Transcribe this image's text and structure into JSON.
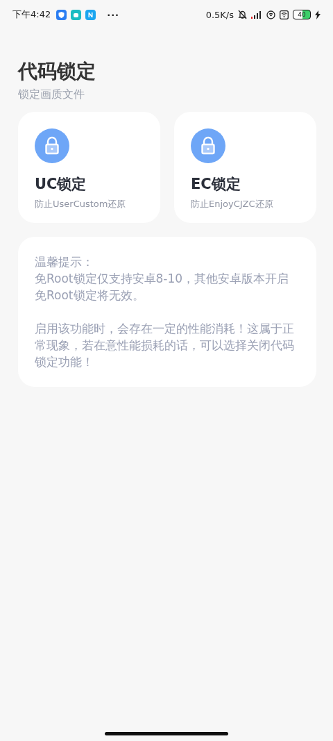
{
  "status_bar": {
    "time": "下午4:42",
    "more": "···",
    "speed": "0.5K/s",
    "battery": "40"
  },
  "header": {
    "title": "代码锁定",
    "subtitle": "锁定画质文件"
  },
  "cards": [
    {
      "title": "UC锁定",
      "subtitle": "防止UserCustom还原"
    },
    {
      "title": "EC锁定",
      "subtitle": "防止EnjoyCJZC还原"
    }
  ],
  "notice": {
    "heading": "温馨提示：",
    "paragraphs": [
      "免Root锁定仅支持安卓8-10，其他安卓版本开启免Root锁定将无效。",
      "启用该功能时，会存在一定的性能消耗！这属于正常现象，若在意性能损耗的话，可以选择关闭代码锁定功能！"
    ]
  }
}
